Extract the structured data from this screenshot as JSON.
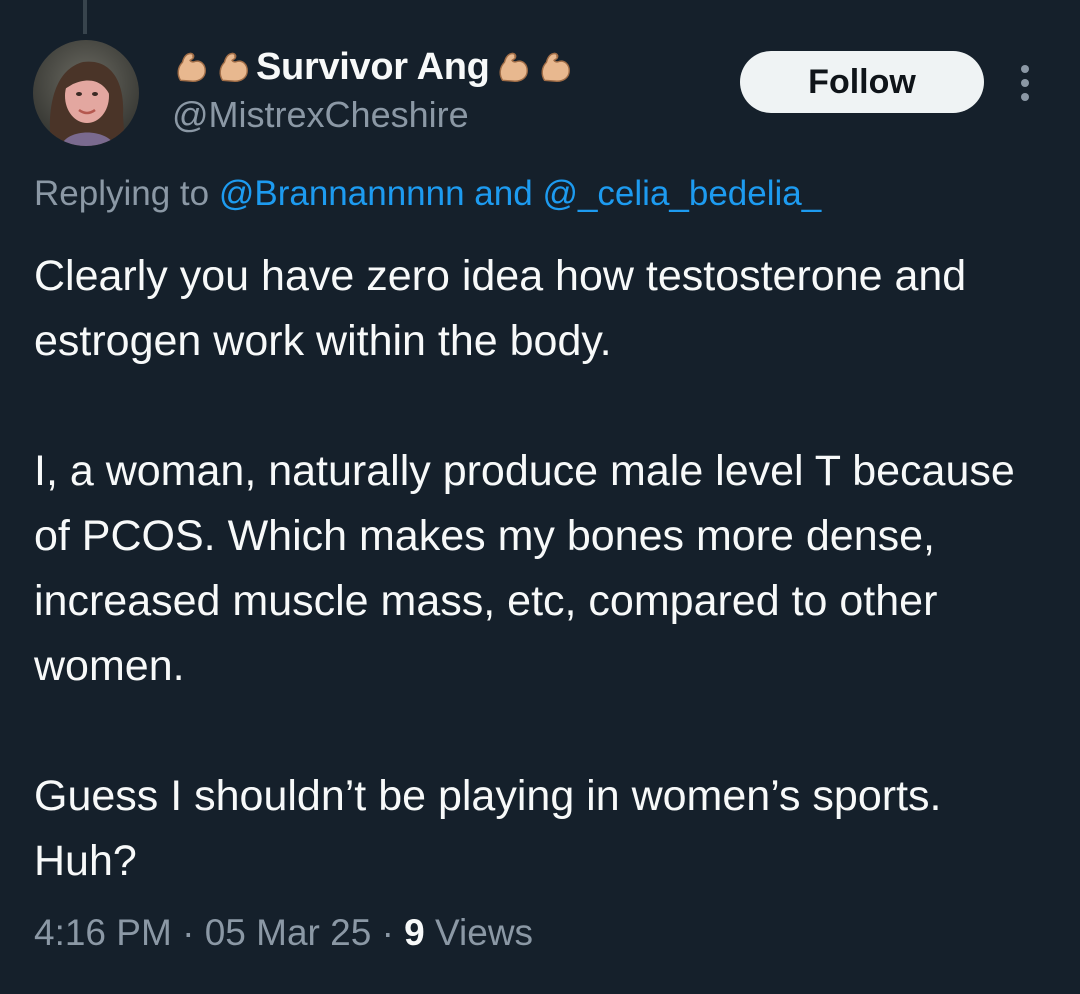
{
  "tweet": {
    "display_name": "Survivor Ang",
    "name_emoji_before": [
      "flexed-biceps-icon",
      "flexed-biceps-icon"
    ],
    "name_emoji_after": [
      "flexed-biceps-icon",
      "flexed-biceps-icon"
    ],
    "handle": "@MistrexCheshire",
    "follow_label": "Follow",
    "replying_prefix": "Replying to",
    "reply_mention_1": "@Brannannnnn",
    "reply_and": "and",
    "reply_mention_2": "@_celia_bedelia_",
    "paragraphs": [
      "Clearly you have zero idea how testosterone and estrogen work within the body.",
      "I, a woman, naturally produce male level T because of PCOS. Which makes my bones more dense, increased muscle mass, etc, compared to other women.",
      "Guess I shouldn’t be playing in women’s sports. Huh?"
    ],
    "time": "4:16 PM",
    "separator": "·",
    "date": "05 Mar 25",
    "views_count": "9",
    "views_label": "Views"
  },
  "colors": {
    "background": "#15202b",
    "text_primary": "#f7f9f9",
    "text_secondary": "#8b98a5",
    "link": "#1d9bf0",
    "follow_bg": "#eff3f4"
  }
}
